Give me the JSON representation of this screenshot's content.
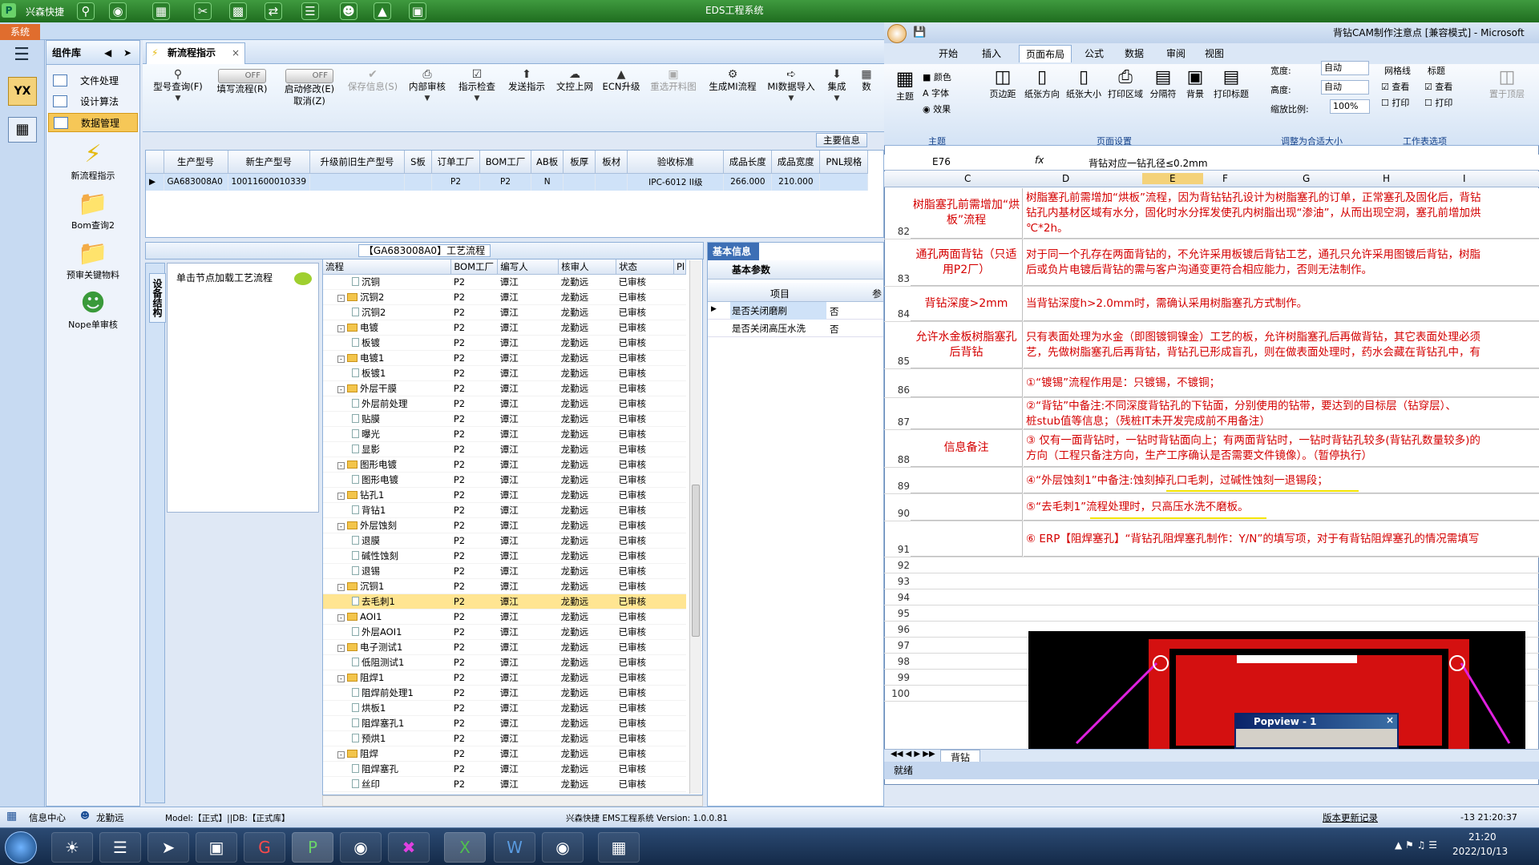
{
  "app": {
    "name": "兴森快捷",
    "window_title": "EDS工程系统",
    "sys_tab": "系统"
  },
  "component_panel": {
    "title": "组件库",
    "items": [
      {
        "label": "文件处理"
      },
      {
        "label": "设计算法"
      },
      {
        "label": "数据管理",
        "selected": true
      }
    ],
    "big_icons": [
      {
        "label": "新流程指示",
        "icon": "lightning-icon"
      },
      {
        "label": "Bom查询2",
        "icon": "folder-icon"
      },
      {
        "label": "预审关键物料",
        "icon": "folder-icon"
      },
      {
        "label": "Nope单审核",
        "icon": "user-icon"
      }
    ]
  },
  "main_tab": {
    "label": "新流程指示"
  },
  "toolbar": {
    "items": [
      {
        "label": "型号查询(F)",
        "disabled": false
      },
      {
        "label": "填写流程(R)",
        "toggle": "OFF"
      },
      {
        "label": "启动修改(E)",
        "sub": "取消(Z)",
        "toggle": "OFF"
      },
      {
        "label": "保存信息(S)",
        "disabled": true
      },
      {
        "label": "内部审核",
        "disabled": false
      },
      {
        "label": "指示检查",
        "disabled": false
      },
      {
        "label": "发送指示",
        "disabled": false
      },
      {
        "label": "文控上网",
        "disabled": false
      },
      {
        "label": "ECN升级",
        "disabled": false
      },
      {
        "label": "重选开料图",
        "disabled": true
      },
      {
        "label": "生成MI流程",
        "disabled": false
      },
      {
        "label": "MI数据导入",
        "disabled": false
      },
      {
        "label": "集成",
        "disabled": false
      },
      {
        "label": "数",
        "disabled": false
      }
    ],
    "main_info_label": "主要信息"
  },
  "product_grid": {
    "headers": [
      "生产型号",
      "新生产型号",
      "升级前旧生产型号",
      "S板",
      "订单工厂",
      "BOM工厂",
      "AB板",
      "板厚",
      "板材",
      "验收标准",
      "成品长度",
      "成品宽度",
      "PNL规格"
    ],
    "row": [
      "GA683008A0",
      "10011600010339",
      "",
      "",
      "P2",
      "P2",
      "N",
      "",
      "",
      "IPC-6012 II级",
      "266.000",
      "210.000",
      ""
    ]
  },
  "flow_panel": {
    "header": "【GA683008A0】工艺流程",
    "side_tab": "设备结构",
    "hint": "单击节点加载工艺流程",
    "columns": [
      "流程",
      "BOM工厂",
      "编写人",
      "核审人",
      "状态",
      "Pl"
    ],
    "rows": [
      {
        "n": "沉铜",
        "lvl": 2,
        "f": "P2",
        "w": "谭江",
        "r": "龙勤远",
        "s": "已审核"
      },
      {
        "n": "沉铜2",
        "lvl": 1,
        "f": "P2",
        "w": "谭江",
        "r": "龙勤远",
        "s": "已审核"
      },
      {
        "n": "沉铜2",
        "lvl": 2,
        "f": "P2",
        "w": "谭江",
        "r": "龙勤远",
        "s": "已审核"
      },
      {
        "n": "电镀",
        "lvl": 1,
        "f": "P2",
        "w": "谭江",
        "r": "龙勤远",
        "s": "已审核"
      },
      {
        "n": "板镀",
        "lvl": 2,
        "f": "P2",
        "w": "谭江",
        "r": "龙勤远",
        "s": "已审核"
      },
      {
        "n": "电镀1",
        "lvl": 1,
        "f": "P2",
        "w": "谭江",
        "r": "龙勤远",
        "s": "已审核"
      },
      {
        "n": "板镀1",
        "lvl": 2,
        "f": "P2",
        "w": "谭江",
        "r": "龙勤远",
        "s": "已审核"
      },
      {
        "n": "外层干膜",
        "lvl": 1,
        "f": "P2",
        "w": "谭江",
        "r": "龙勤远",
        "s": "已审核"
      },
      {
        "n": "外层前处理",
        "lvl": 2,
        "f": "P2",
        "w": "谭江",
        "r": "龙勤远",
        "s": "已审核"
      },
      {
        "n": "贴膜",
        "lvl": 2,
        "f": "P2",
        "w": "谭江",
        "r": "龙勤远",
        "s": "已审核"
      },
      {
        "n": "曝光",
        "lvl": 2,
        "f": "P2",
        "w": "谭江",
        "r": "龙勤远",
        "s": "已审核"
      },
      {
        "n": "显影",
        "lvl": 2,
        "f": "P2",
        "w": "谭江",
        "r": "龙勤远",
        "s": "已审核"
      },
      {
        "n": "图形电镀",
        "lvl": 1,
        "f": "P2",
        "w": "谭江",
        "r": "龙勤远",
        "s": "已审核"
      },
      {
        "n": "图形电镀",
        "lvl": 2,
        "f": "P2",
        "w": "谭江",
        "r": "龙勤远",
        "s": "已审核"
      },
      {
        "n": "钻孔1",
        "lvl": 1,
        "f": "P2",
        "w": "谭江",
        "r": "龙勤远",
        "s": "已审核"
      },
      {
        "n": "背钻1",
        "lvl": 2,
        "f": "P2",
        "w": "谭江",
        "r": "龙勤远",
        "s": "已审核"
      },
      {
        "n": "外层蚀刻",
        "lvl": 1,
        "f": "P2",
        "w": "谭江",
        "r": "龙勤远",
        "s": "已审核"
      },
      {
        "n": "退膜",
        "lvl": 2,
        "f": "P2",
        "w": "谭江",
        "r": "龙勤远",
        "s": "已审核"
      },
      {
        "n": "碱性蚀刻",
        "lvl": 2,
        "f": "P2",
        "w": "谭江",
        "r": "龙勤远",
        "s": "已审核"
      },
      {
        "n": "退锡",
        "lvl": 2,
        "f": "P2",
        "w": "谭江",
        "r": "龙勤远",
        "s": "已审核"
      },
      {
        "n": "沉铜1",
        "lvl": 1,
        "f": "P2",
        "w": "谭江",
        "r": "龙勤远",
        "s": "已审核"
      },
      {
        "n": "去毛刺1",
        "lvl": 2,
        "f": "P2",
        "w": "谭江",
        "r": "龙勤远",
        "s": "已审核",
        "sel": true
      },
      {
        "n": "AOI1",
        "lvl": 1,
        "f": "P2",
        "w": "谭江",
        "r": "龙勤远",
        "s": "已审核"
      },
      {
        "n": "外层AOI1",
        "lvl": 2,
        "f": "P2",
        "w": "谭江",
        "r": "龙勤远",
        "s": "已审核"
      },
      {
        "n": "电子测试1",
        "lvl": 1,
        "f": "P2",
        "w": "谭江",
        "r": "龙勤远",
        "s": "已审核"
      },
      {
        "n": "低阻测试1",
        "lvl": 2,
        "f": "P2",
        "w": "谭江",
        "r": "龙勤远",
        "s": "已审核"
      },
      {
        "n": "阻焊1",
        "lvl": 1,
        "f": "P2",
        "w": "谭江",
        "r": "龙勤远",
        "s": "已审核"
      },
      {
        "n": "阻焊前处理1",
        "lvl": 2,
        "f": "P2",
        "w": "谭江",
        "r": "龙勤远",
        "s": "已审核"
      },
      {
        "n": "烘板1",
        "lvl": 2,
        "f": "P2",
        "w": "谭江",
        "r": "龙勤远",
        "s": "已审核"
      },
      {
        "n": "阻焊塞孔1",
        "lvl": 2,
        "f": "P2",
        "w": "谭江",
        "r": "龙勤远",
        "s": "已审核"
      },
      {
        "n": "预烘1",
        "lvl": 2,
        "f": "P2",
        "w": "谭江",
        "r": "龙勤远",
        "s": "已审核"
      },
      {
        "n": "阻焊",
        "lvl": 1,
        "f": "P2",
        "w": "谭江",
        "r": "龙勤远",
        "s": "已审核"
      },
      {
        "n": "阻焊塞孔",
        "lvl": 2,
        "f": "P2",
        "w": "谭江",
        "r": "龙勤远",
        "s": "已审核"
      },
      {
        "n": "丝印",
        "lvl": 2,
        "f": "P2",
        "w": "谭江",
        "r": "龙勤远",
        "s": "已审核"
      }
    ]
  },
  "basic_info": {
    "tab": "基本信息",
    "sub": "基本参数",
    "col_item": "项目",
    "col_val": "参",
    "rows": [
      {
        "k": "是否关闭磨刷",
        "v": "否"
      },
      {
        "k": "是否关闭高压水洗",
        "v": "否"
      }
    ]
  },
  "statusbar": {
    "info": "信息中心",
    "user": "龙勤远",
    "model": "Model:【正式】||DB:【正式库】",
    "version": "兴森快捷 EMS工程系统 Version: 1.0.0.81",
    "update": "版本更新记录",
    "time": "-13 21:20:37"
  },
  "taskbar": {
    "clock": "21:20",
    "date": "2022/10/13"
  },
  "excel": {
    "title": "背钻CAM制作注意点 [兼容模式] - Microsoft",
    "menu": [
      "开始",
      "插入",
      "页面布局",
      "公式",
      "数据",
      "审阅",
      "视图"
    ],
    "ribbon": {
      "theme": "主题",
      "colors": "颜色",
      "fonts": "字体",
      "effects": "效果",
      "margins": "页边距",
      "orientation": "纸张方向",
      "size": "纸张大小",
      "print_area": "打印区域",
      "breaks": "分隔符",
      "background": "背景",
      "print_titles": "打印标题",
      "width": "宽度:",
      "height": "高度:",
      "scale": "缩放比例:",
      "auto1": "自动",
      "auto2": "自动",
      "scale_val": "100%",
      "gridlines": "网格线",
      "headings": "标题",
      "view1": "查看",
      "print1": "打印",
      "view2": "查看",
      "print2": "打印",
      "bring": "置于顶层",
      "grp_theme": "主题",
      "grp_page": "页面设置",
      "grp_fit": "调整为合适大小",
      "grp_sheet": "工作表选项"
    },
    "cell_ref": "E76",
    "formula": "背钻对应一钻孔径≤0.2mm",
    "columns": [
      "C",
      "D",
      "E",
      "F",
      "G",
      "H",
      "I"
    ],
    "rows": [
      {
        "num": "82",
        "c": "树脂塞孔前需增加“烘板”流程",
        "d": [
          "树脂塞孔前需增加“烘板”流程，因为背钻钻孔设计为树脂塞孔的订单，正常塞孔及固化后，背钻",
          "钻孔内基材区域有水分，固化时水分挥发使孔内树脂出现“渗油”，从而出现空洞，塞孔前增加烘",
          "℃*2h。"
        ]
      },
      {
        "num": "83",
        "c": "通孔两面背钻（只适用P2厂）",
        "d": [
          "对于同一个孔存在两面背钻的，不允许采用板镀后背钻工艺，通孔只允许采用图镀后背钻，树脂",
          "后或负片电镀后背钻的需与客户沟通变更符合相应能力，否则无法制作。"
        ]
      },
      {
        "num": "84",
        "c": "背钻深度>2mm",
        "d": [
          "当背钻深度h>2.0mm时，需确认采用树脂塞孔方式制作。"
        ]
      },
      {
        "num": "85",
        "c": "允许水金板树脂塞孔后背钻",
        "d": [
          "只有表面处理为水金（即图镀铜镍金）工艺的板，允许树脂塞孔后再做背钻，其它表面处理必须",
          "艺，先做树脂塞孔后再背钻，背钻孔已形成盲孔，则在做表面处理时，药水会藏在背钻孔中，有"
        ]
      },
      {
        "num": "86",
        "c": "",
        "d": [
          "①“镀锡”流程作用是：只镀锡，不镀铜；"
        ]
      },
      {
        "num": "87",
        "c": "",
        "d": [
          "②“背钻”中备注:不同深度背钻孔的下钻面，分别使用的钻带，要达到的目标层（钻穿层）、",
          "桩stub值等信息；（残桩IT未开发完成前不用备注）"
        ]
      },
      {
        "num": "88",
        "c": "信息备注",
        "d": [
          "③ 仅有一面背钻时，一钻时背钻面向上；有两面背钻时，一钻时背钻孔较多(背钻孔数量较多)的",
          "方向（工程只备注方向，生产工序确认是否需要文件镜像）。（暂停执行）"
        ]
      },
      {
        "num": "89",
        "c": "",
        "d": [
          "④“外层蚀刻1”中备注:蚀刻掉孔口毛刺，过碱性蚀刻一退锡段；"
        ]
      },
      {
        "num": "90",
        "c": "",
        "d": [
          "⑤“去毛刺1”流程处理时，只高压水洗不磨板。"
        ]
      },
      {
        "num": "91",
        "c": "",
        "d": [
          "⑥ ERP【阻焊塞孔】“背钻孔阻焊塞孔制作：Y/N”的填写项，对于有背钻阻焊塞孔的情况需填写"
        ]
      },
      {
        "num": "92"
      },
      {
        "num": "93"
      },
      {
        "num": "94"
      },
      {
        "num": "95"
      },
      {
        "num": "96"
      },
      {
        "num": "97"
      },
      {
        "num": "98"
      },
      {
        "num": "99"
      },
      {
        "num": "100"
      }
    ],
    "sheet_tab": "背钻",
    "status": "就绪",
    "popview": "Popview - 1"
  }
}
